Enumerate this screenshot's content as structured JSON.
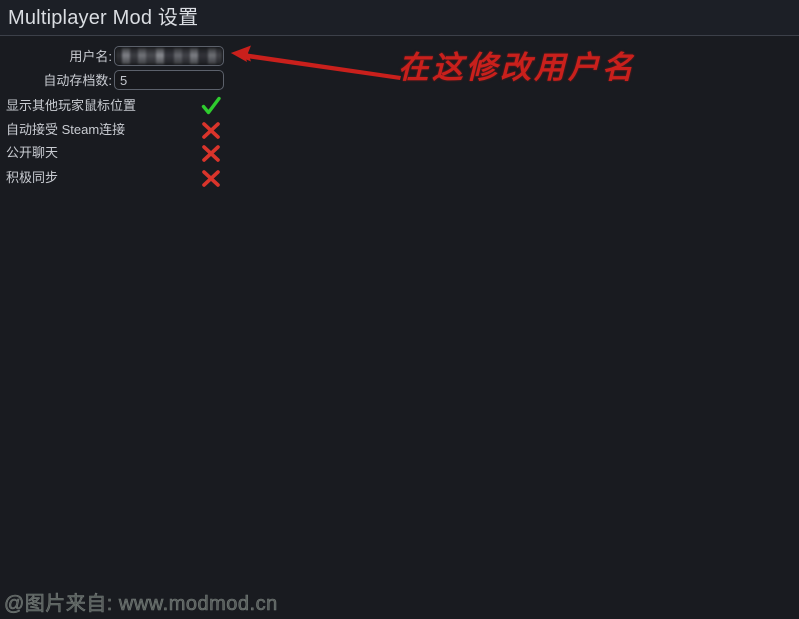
{
  "window": {
    "title": "Multiplayer Mod 设置"
  },
  "colors": {
    "background": "#191b20",
    "titlebar": "#1c1f26",
    "divider": "#3c4049",
    "text": "#c9ccd2",
    "title_text": "#dadde2",
    "field_border": "#5c616b",
    "field_fill": "#17181c",
    "enabled_mark": "#2ecc2e",
    "disabled_mark": "#d9342b",
    "annotation": "#c9201c",
    "watermark": "#5c6360"
  },
  "fields": [
    {
      "label": "用户名:",
      "value": "",
      "censored": true,
      "name": "username"
    },
    {
      "label": "自动存档数:",
      "value": "5",
      "censored": false,
      "name": "autosave-count"
    }
  ],
  "toggles": [
    {
      "label": "显示其他玩家鼠标位置",
      "state": "enabled",
      "mark": "check-icon",
      "name": "show-other-players-cursor"
    },
    {
      "label": "自动接受 Steam连接",
      "state": "disabled",
      "mark": "cross-icon",
      "name": "auto-accept-steam-connection"
    },
    {
      "label": "公开聊天",
      "state": "disabled",
      "mark": "cross-icon",
      "name": "public-chat"
    },
    {
      "label": "积极同步",
      "state": "disabled",
      "mark": "cross-icon",
      "name": "aggressive-sync"
    }
  ],
  "annotation": {
    "text": "在这修改用户名",
    "arrow": "left-pointing-arrow",
    "color": "#c9201c"
  },
  "watermark": {
    "text": "@图片来自: www.modmod.cn"
  }
}
